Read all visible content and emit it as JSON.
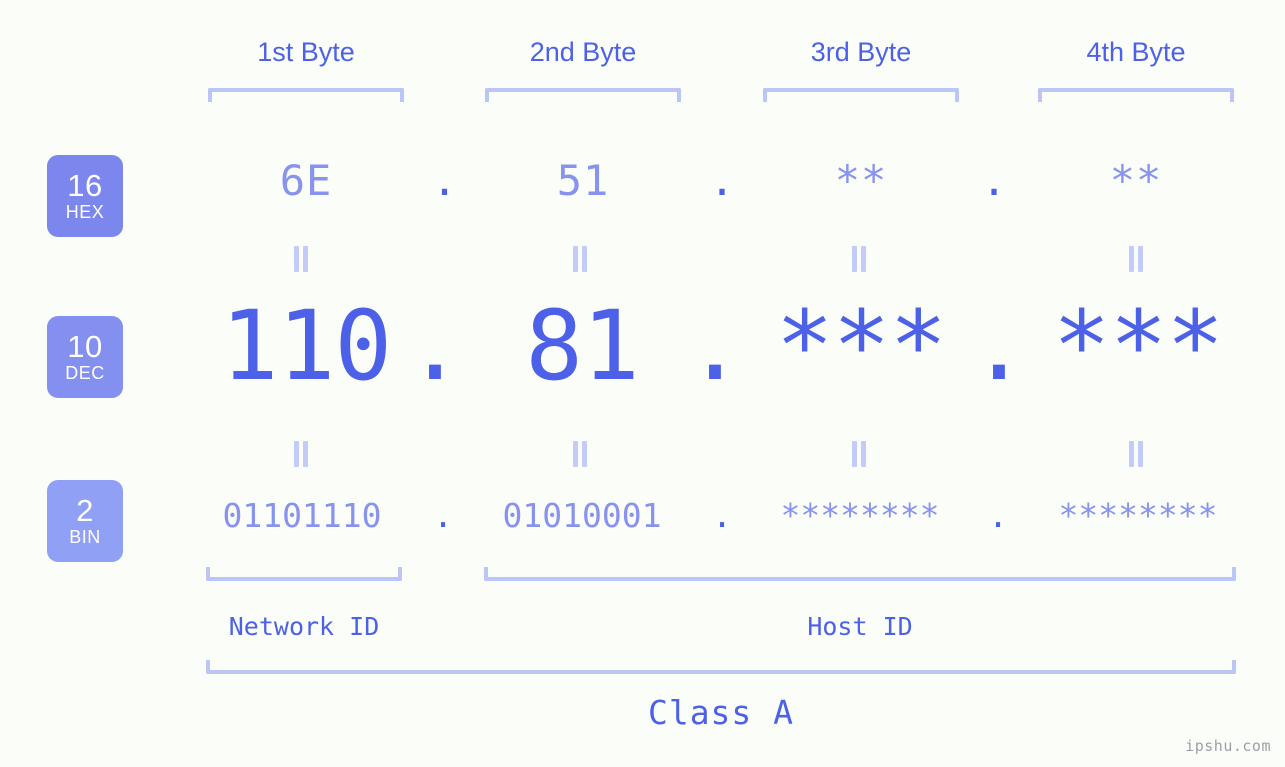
{
  "meta": {
    "background_color": "#fbfdf8",
    "accent_color": "#4d61e8",
    "muted_accent_color": "#8892ef",
    "bracket_color": "#bcc5f7",
    "watermark": "ipshu.com"
  },
  "byte_headers": [
    {
      "label": "1st Byte"
    },
    {
      "label": "2nd Byte"
    },
    {
      "label": "3rd Byte"
    },
    {
      "label": "4th Byte"
    }
  ],
  "bases": [
    {
      "number": "16",
      "abbr": "HEX",
      "color": "#7b87ec"
    },
    {
      "number": "10",
      "abbr": "DEC",
      "color": "#8490ef"
    },
    {
      "number": "2",
      "abbr": "BIN",
      "color": "#8fa0f5"
    }
  ],
  "rows": {
    "hex": {
      "values": [
        "6E",
        "51",
        "**",
        "**"
      ],
      "separator": "."
    },
    "dec": {
      "values": [
        "110",
        "81",
        "***",
        "***"
      ],
      "separator": "."
    },
    "bin": {
      "values": [
        "01101110",
        "01010001",
        "********",
        "********"
      ],
      "separator": "."
    }
  },
  "equals_symbol": "=",
  "segments": {
    "network_id": "Network ID",
    "host_id": "Host ID"
  },
  "class_label": "Class A"
}
